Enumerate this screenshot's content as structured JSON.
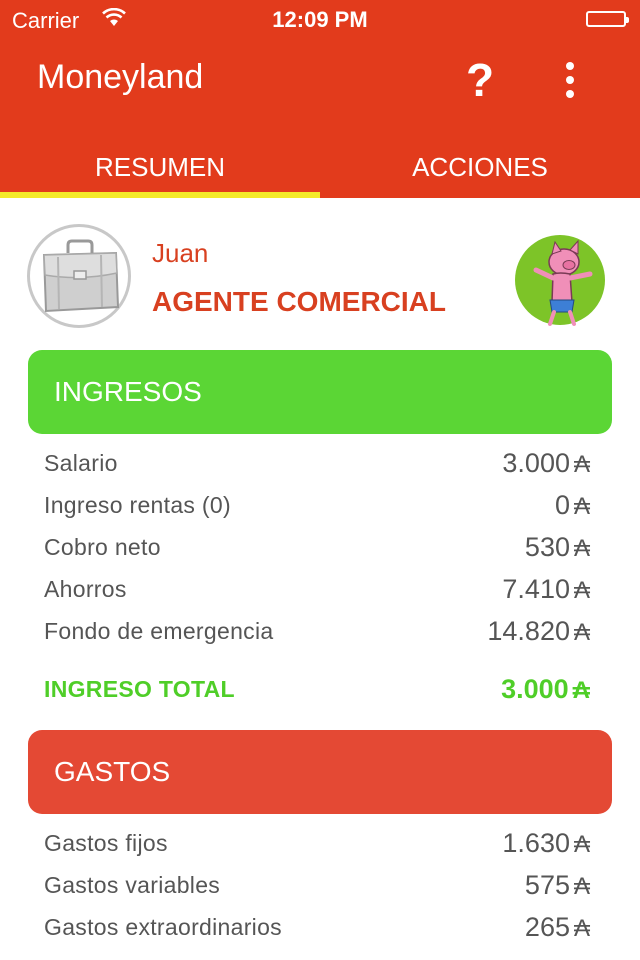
{
  "status": {
    "carrier": "Carrier",
    "time": "12:09 PM"
  },
  "appbar": {
    "title": "Moneyland",
    "help": "?"
  },
  "tabs": [
    {
      "label": "RESUMEN",
      "active": true
    },
    {
      "label": "ACCIONES",
      "active": false
    }
  ],
  "profile": {
    "name": "Juan",
    "job": "AGENTE COMERCIAL"
  },
  "currency": "₳",
  "ingresos": {
    "title": "INGRESOS",
    "color": "#5bd635",
    "rows": [
      {
        "label": "Salario",
        "value": "3.000"
      },
      {
        "label": "Ingreso rentas (0)",
        "value": "0"
      },
      {
        "label": "Cobro neto",
        "value": "530"
      },
      {
        "label": "Ahorros",
        "value": "7.410"
      },
      {
        "label": "Fondo de emergencia",
        "value": "14.820"
      }
    ],
    "total": {
      "label": "INGRESO TOTAL",
      "value": "3.000"
    }
  },
  "gastos": {
    "title": "GASTOS",
    "color": "#e44934",
    "rows": [
      {
        "label": "Gastos fijos",
        "value": "1.630"
      },
      {
        "label": "Gastos variables",
        "value": "575"
      },
      {
        "label": "Gastos extraordinarios",
        "value": "265"
      }
    ]
  },
  "colors": {
    "appbar": "#e23b1c",
    "tab_indicator": "#f4ea2a",
    "accent_text": "#d84020"
  }
}
